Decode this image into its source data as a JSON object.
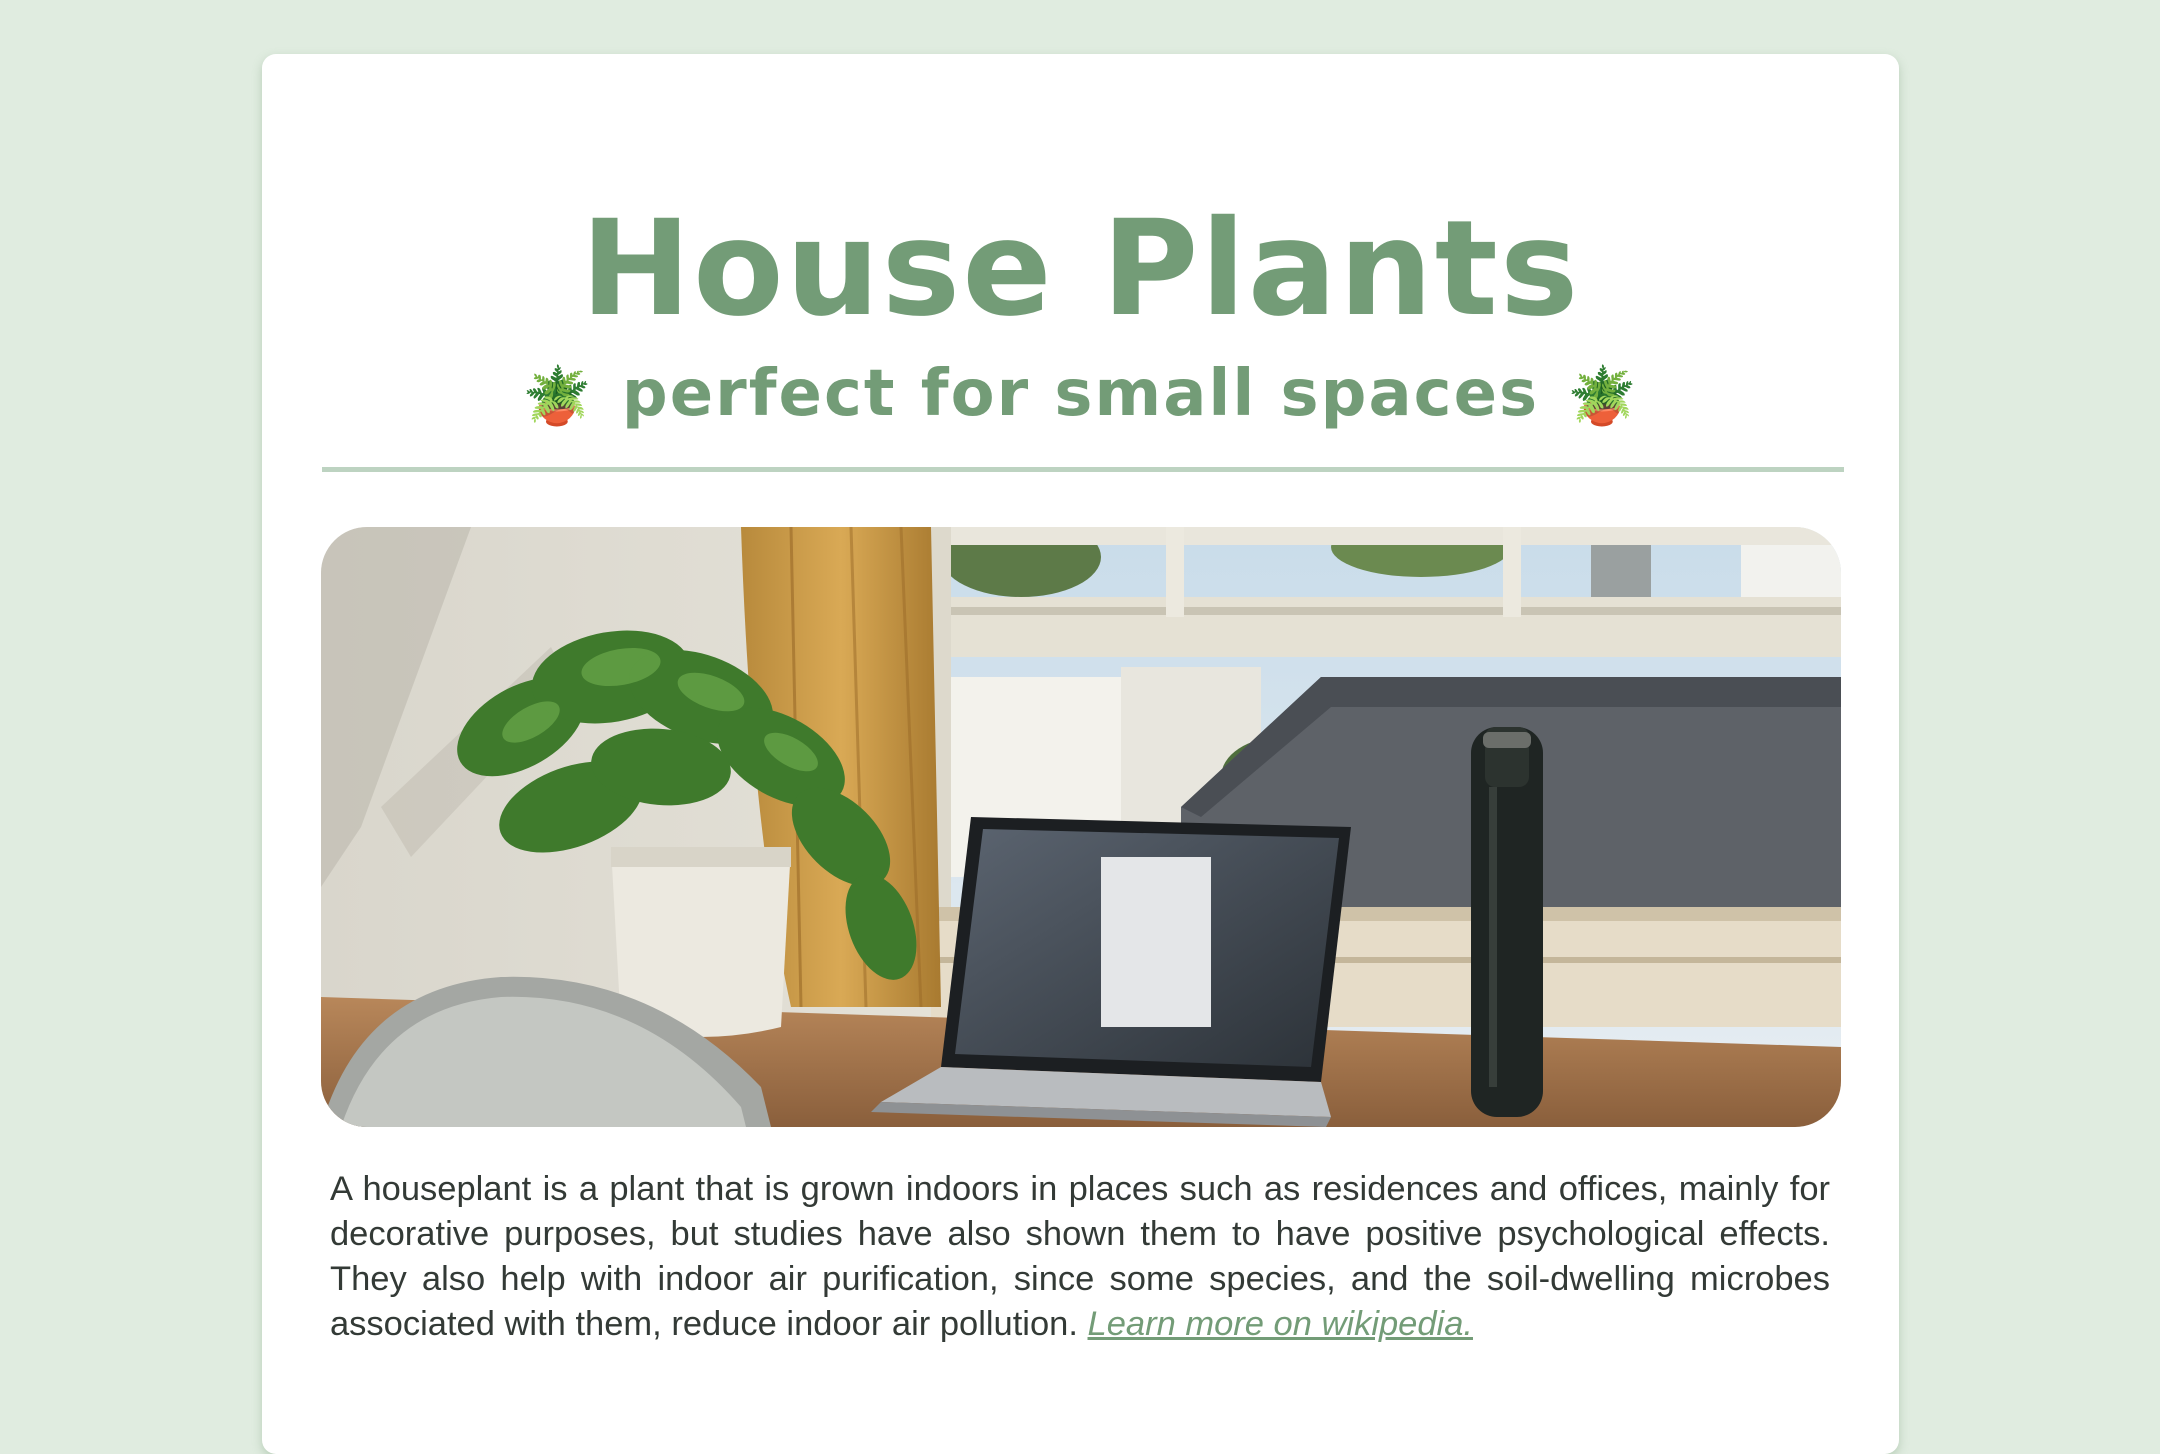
{
  "page": {
    "title": "House Plants",
    "subtitle_text": "perfect for small spaces",
    "subtitle_emoji": "🪴",
    "image_alt": "Houseplant on a desk next to a laptop and water bottle by a window",
    "description": "A houseplant is a plant that is grown indoors in places such as residences and offices, mainly for decorative purposes, but studies have also shown them to have positive psychological effects. They also help with indoor air purification, since some species, and the soil-dwelling microbes associated with them, reduce indoor air pollution.",
    "link_text": "Learn more on wikipedia."
  },
  "colors": {
    "background": "#e0ece0",
    "accent": "#739c77",
    "divider": "#bdd3c1",
    "text": "#333a36"
  },
  "icons": [
    "potted-plant-icon"
  ]
}
